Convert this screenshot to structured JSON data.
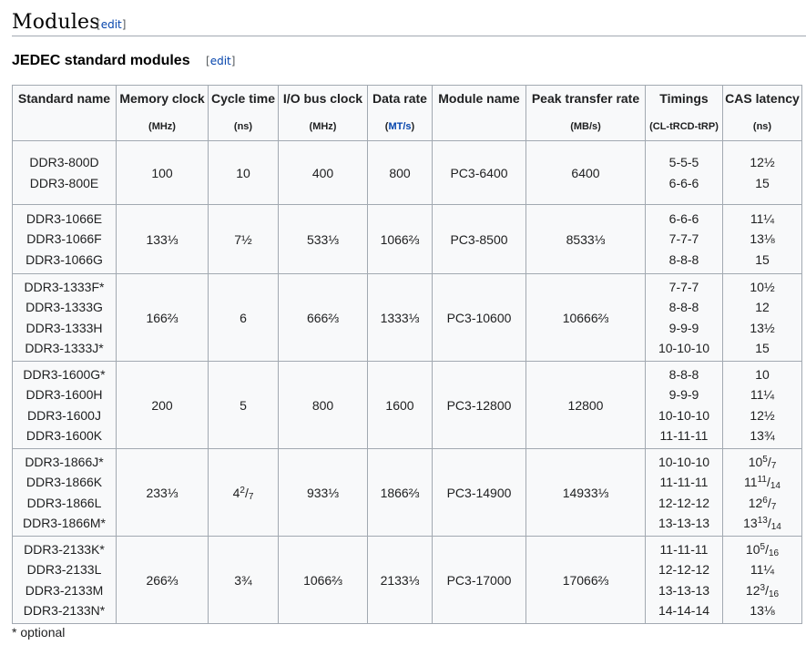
{
  "section": {
    "title": "Modules",
    "edit": "edit"
  },
  "subsection": {
    "title": "JEDEC standard modules",
    "edit": "edit"
  },
  "headers": [
    {
      "name": "Standard name",
      "unit": ""
    },
    {
      "name": "Memory clock",
      "unit": "(MHz)"
    },
    {
      "name": "Cycle time",
      "unit": "(ns)"
    },
    {
      "name": "I/O bus clock",
      "unit": "(MHz)"
    },
    {
      "name": "Data rate",
      "unit": "MT/s"
    },
    {
      "name": "Module name",
      "unit": ""
    },
    {
      "name": "Peak transfer rate",
      "unit": "(MB/s)"
    },
    {
      "name": "Timings",
      "unit": "(CL-tRCD-tRP)"
    },
    {
      "name": "CAS latency",
      "unit": "(ns)"
    }
  ],
  "rows": [
    {
      "standard": [
        "DDR3-800D",
        "DDR3-800E"
      ],
      "memory_clock": "100",
      "cycle_time": "10",
      "io_bus_clock": "400",
      "data_rate": "800",
      "module": "PC3-6400",
      "peak": "6400",
      "timings": [
        "5-5-5",
        "6-6-6"
      ],
      "cas": [
        "12½",
        "15"
      ]
    },
    {
      "standard": [
        "DDR3-1066E",
        "DDR3-1066F",
        "DDR3-1066G"
      ],
      "memory_clock": "133⅓",
      "cycle_time": "7½",
      "io_bus_clock": "533⅓",
      "data_rate": "1066⅔",
      "module": "PC3-8500",
      "peak": "8533⅓",
      "timings": [
        "6-6-6",
        "7-7-7",
        "8-8-8"
      ],
      "cas": [
        "11¼",
        "13⅛",
        "15"
      ]
    },
    {
      "standard": [
        "DDR3-1333F*",
        "DDR3-1333G",
        "DDR3-1333H",
        "DDR3-1333J*"
      ],
      "memory_clock": "166⅔",
      "cycle_time": "6",
      "io_bus_clock": "666⅔",
      "data_rate": "1333⅓",
      "module": "PC3-10600",
      "peak": "10666⅔",
      "timings": [
        "7-7-7",
        "8-8-8",
        "9-9-9",
        "10-10-10"
      ],
      "cas": [
        "10½",
        "12",
        "13½",
        "15"
      ]
    },
    {
      "standard": [
        "DDR3-1600G*",
        "DDR3-1600H",
        "DDR3-1600J",
        "DDR3-1600K"
      ],
      "memory_clock": "200",
      "cycle_time": "5",
      "io_bus_clock": "800",
      "data_rate": "1600",
      "module": "PC3-12800",
      "peak": "12800",
      "timings": [
        "8-8-8",
        "9-9-9",
        "10-10-10",
        "11-11-11"
      ],
      "cas": [
        "10",
        "11¼",
        "12½",
        "13¾"
      ]
    },
    {
      "standard": [
        "DDR3-1866J*",
        "DDR3-1866K",
        "DDR3-1866L",
        "DDR3-1866M*"
      ],
      "memory_clock": "233⅓",
      "cycle_time": "4 2/7",
      "io_bus_clock": "933⅓",
      "data_rate": "1866⅔",
      "module": "PC3-14900",
      "peak": "14933⅓",
      "timings": [
        "10-10-10",
        "11-11-11",
        "12-12-12",
        "13-13-13"
      ],
      "cas": [
        "10 5/7",
        "11 11/14",
        "12 6/7",
        "13 13/14"
      ]
    },
    {
      "standard": [
        "DDR3-2133K*",
        "DDR3-2133L",
        "DDR3-2133M",
        "DDR3-2133N*"
      ],
      "memory_clock": "266⅔",
      "cycle_time": "3¾",
      "io_bus_clock": "1066⅔",
      "data_rate": "2133⅓",
      "module": "PC3-17000",
      "peak": "17066⅔",
      "timings": [
        "11-11-11",
        "12-12-12",
        "13-13-13",
        "14-14-14"
      ],
      "cas": [
        "10 5/16",
        "11¼",
        "12 3/16",
        "13⅛"
      ]
    }
  ],
  "footnote": "* optional"
}
